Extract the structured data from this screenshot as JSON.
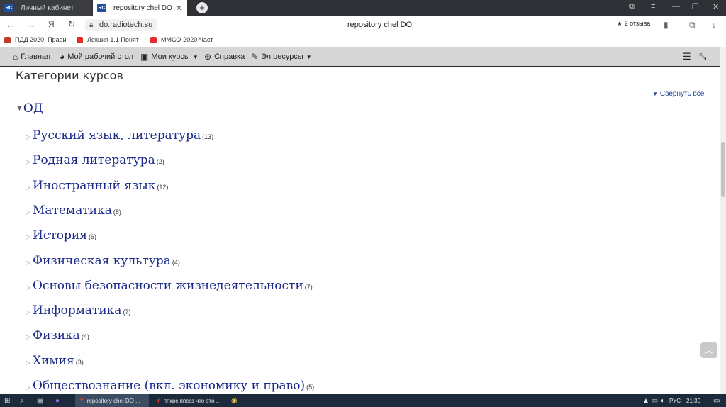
{
  "browser": {
    "tabs": [
      {
        "label": "Личный кабинет",
        "favicon": "RC"
      },
      {
        "label": "repository chel DO",
        "favicon": "RC"
      }
    ],
    "address": "do.radiotech.su",
    "page_title": "repository chel DO",
    "reviews": "2 отзыва",
    "bookmarks": [
      {
        "label": "ПДД 2020. Прави",
        "color": "#c0392b"
      },
      {
        "label": "Лекция 1.1 Понят",
        "color": "#e52d27"
      },
      {
        "label": "ММСО-2020 Част",
        "color": "#e52d27"
      }
    ]
  },
  "site_nav": {
    "items": [
      {
        "label": "Главная"
      },
      {
        "label": "Мой рабочий стол"
      },
      {
        "label": "Мои курсы"
      },
      {
        "label": "Справка"
      },
      {
        "label": "Эл.ресурсы"
      }
    ]
  },
  "main": {
    "heading": "Категории курсов",
    "collapse_all": "Свернуть всё",
    "category": "ОД",
    "courses": [
      {
        "name": "Русский язык, литература",
        "count": "(13)"
      },
      {
        "name": "Родная литература",
        "count": "(2)"
      },
      {
        "name": "Иностранный язык",
        "count": "(12)"
      },
      {
        "name": "Математика",
        "count": "(8)"
      },
      {
        "name": "История",
        "count": "(6)"
      },
      {
        "name": "Физическая культура",
        "count": "(4)"
      },
      {
        "name": "Основы безопасности жизнедеятельности",
        "count": "(7)"
      },
      {
        "name": "Информатика",
        "count": "(7)"
      },
      {
        "name": "Физика",
        "count": "(4)"
      },
      {
        "name": "Химия",
        "count": "(3)"
      },
      {
        "name": "Обществознание (вкл. экономику и право)",
        "count": "(5)"
      }
    ]
  },
  "taskbar": {
    "items": [
      {
        "label": "repository chel DO ..."
      },
      {
        "label": "ппкрс ппссз что это ..."
      }
    ],
    "lang": "РУС",
    "time": "21:30"
  }
}
